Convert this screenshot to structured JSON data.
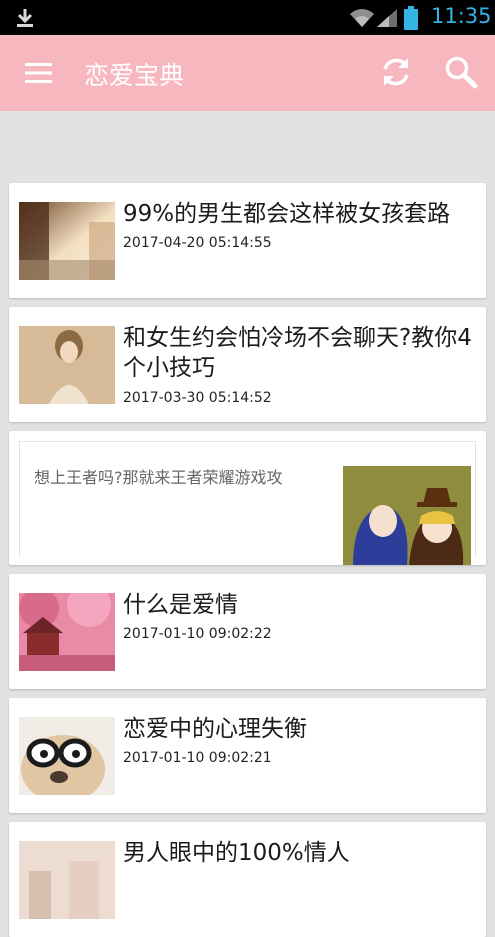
{
  "status_bar": {
    "time": "11:35",
    "icons": [
      "download-icon",
      "wifi-icon",
      "signal-icon",
      "battery-icon"
    ]
  },
  "app_bar": {
    "title": "恋爱宝典",
    "icons": [
      "menu-icon",
      "refresh-icon",
      "search-icon"
    ]
  },
  "articles": [
    {
      "title": "99%的男生都会这样被女孩套路",
      "date": "2017-04-20 05:14:55"
    },
    {
      "title": "和女生约会怕冷场不会聊天?教你4个小技巧",
      "date": "2017-03-30 05:14:52"
    },
    {
      "title": "什么是爱情",
      "date": "2017-01-10 09:02:22"
    },
    {
      "title": "恋爱中的心理失衡",
      "date": "2017-01-10 09:02:21"
    },
    {
      "title": "男人眼中的100%情人",
      "date": ""
    }
  ],
  "ad": {
    "text": "想上王者吗?那就来王者荣耀游戏攻"
  },
  "colors": {
    "app_bar": "#f7b7bf",
    "background": "#e2e2e2",
    "status_bar": "#000000",
    "clock": "#33b5e5"
  }
}
